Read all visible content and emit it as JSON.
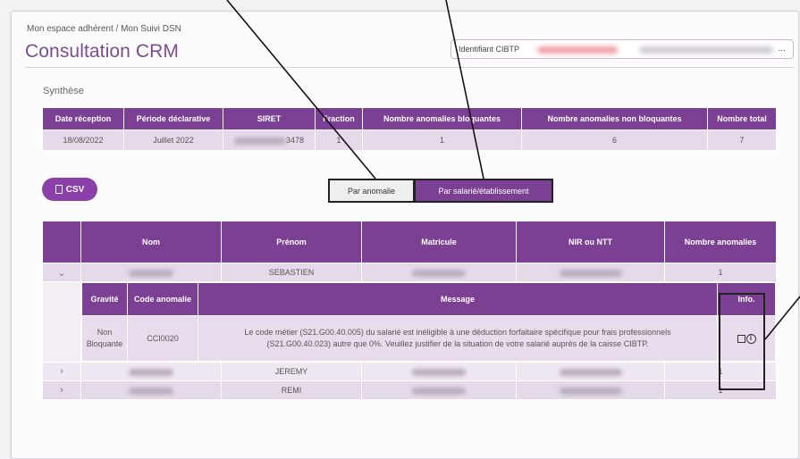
{
  "breadcrumb": "Mon espace adhérent / Mon Suivi DSN",
  "page_title": "Consultation CRM",
  "identifiant": {
    "label": "Identifiant CIBTP",
    "more": "..."
  },
  "section_title": "Synthèse",
  "synthese": {
    "headers": [
      "Date réception",
      "Période déclarative",
      "SIRET",
      "Fraction",
      "Nombre anomalies bloquantes",
      "Nombre anomalies non bloquantes",
      "Nombre total"
    ],
    "row": {
      "date": "18/08/2022",
      "periode": "Juillet 2022",
      "siret_suffix": "3478",
      "fraction": "1",
      "bloquantes": "1",
      "non_bloquantes": "6",
      "total": "7"
    }
  },
  "csv_button": "CSV",
  "toggle": {
    "par_anomalie": "Par anomalie",
    "par_salarie": "Par salarié/établissement"
  },
  "main_table": {
    "headers": [
      "",
      "Nom",
      "Prénom",
      "Matricule",
      "NIR ou NTT",
      "Nombre anomalies"
    ],
    "rows": [
      {
        "chevron": "⌄",
        "prenom": "SEBASTIEN",
        "nb": "1"
      },
      {
        "chevron": "›",
        "prenom": "JEREMY",
        "nb": "1"
      },
      {
        "chevron": "›",
        "prenom": "REMI",
        "nb": "1"
      }
    ],
    "detail": {
      "headers": [
        "Gravité",
        "Code anomalie",
        "Message",
        "Info."
      ],
      "gravite": "Non Bloquante",
      "code": "CCI0020",
      "message": "Le code métier (S21.G00.40.005) du salarié est inéligible à une déduction forfaitaire spécifique pour frais professionnels (S21.G00.40.023) autre que 0%. Veuillez justifier de la situation de votre salarié auprès de la caisse CIBTP."
    }
  }
}
